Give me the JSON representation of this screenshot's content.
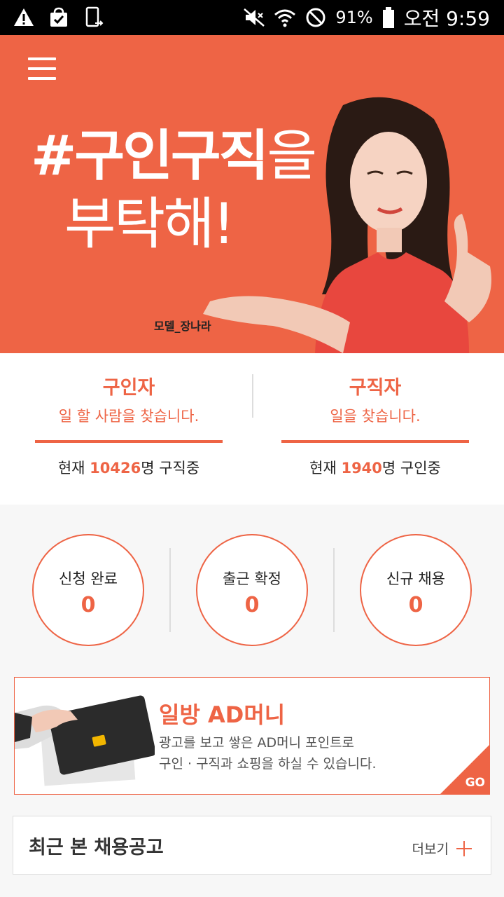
{
  "status_bar": {
    "battery": "91%",
    "time": "오전 9:59"
  },
  "hero": {
    "headline_bold": "#구인구직",
    "headline_tail": "을",
    "headline_line2": "부탁해!",
    "model_caption": "모델_장나라"
  },
  "employer": {
    "title": "구인자",
    "subtitle": "일 할 사람을 찾습니다.",
    "count_prefix": "현재 ",
    "count": "10426",
    "count_suffix": "명 구직중"
  },
  "seeker": {
    "title": "구직자",
    "subtitle": "일을 찾습니다.",
    "count_prefix": "현재 ",
    "count": "1940",
    "count_suffix": "명 구인중"
  },
  "stats": [
    {
      "label": "신청 완료",
      "value": "0"
    },
    {
      "label": "출근 확정",
      "value": "0"
    },
    {
      "label": "신규 채용",
      "value": "0"
    }
  ],
  "ad_money": {
    "title": "일방 AD머니",
    "desc_line1": "광고를 보고 쌓은 AD머니 포인트로",
    "desc_line2": "구인 · 구직과 쇼핑을 하실 수 있습니다.",
    "go_label": "GO"
  },
  "recent": {
    "title": "최근 본 채용공고",
    "more_label": "더보기"
  },
  "colors": {
    "accent": "#ee6445",
    "status_bar": "#000000"
  }
}
